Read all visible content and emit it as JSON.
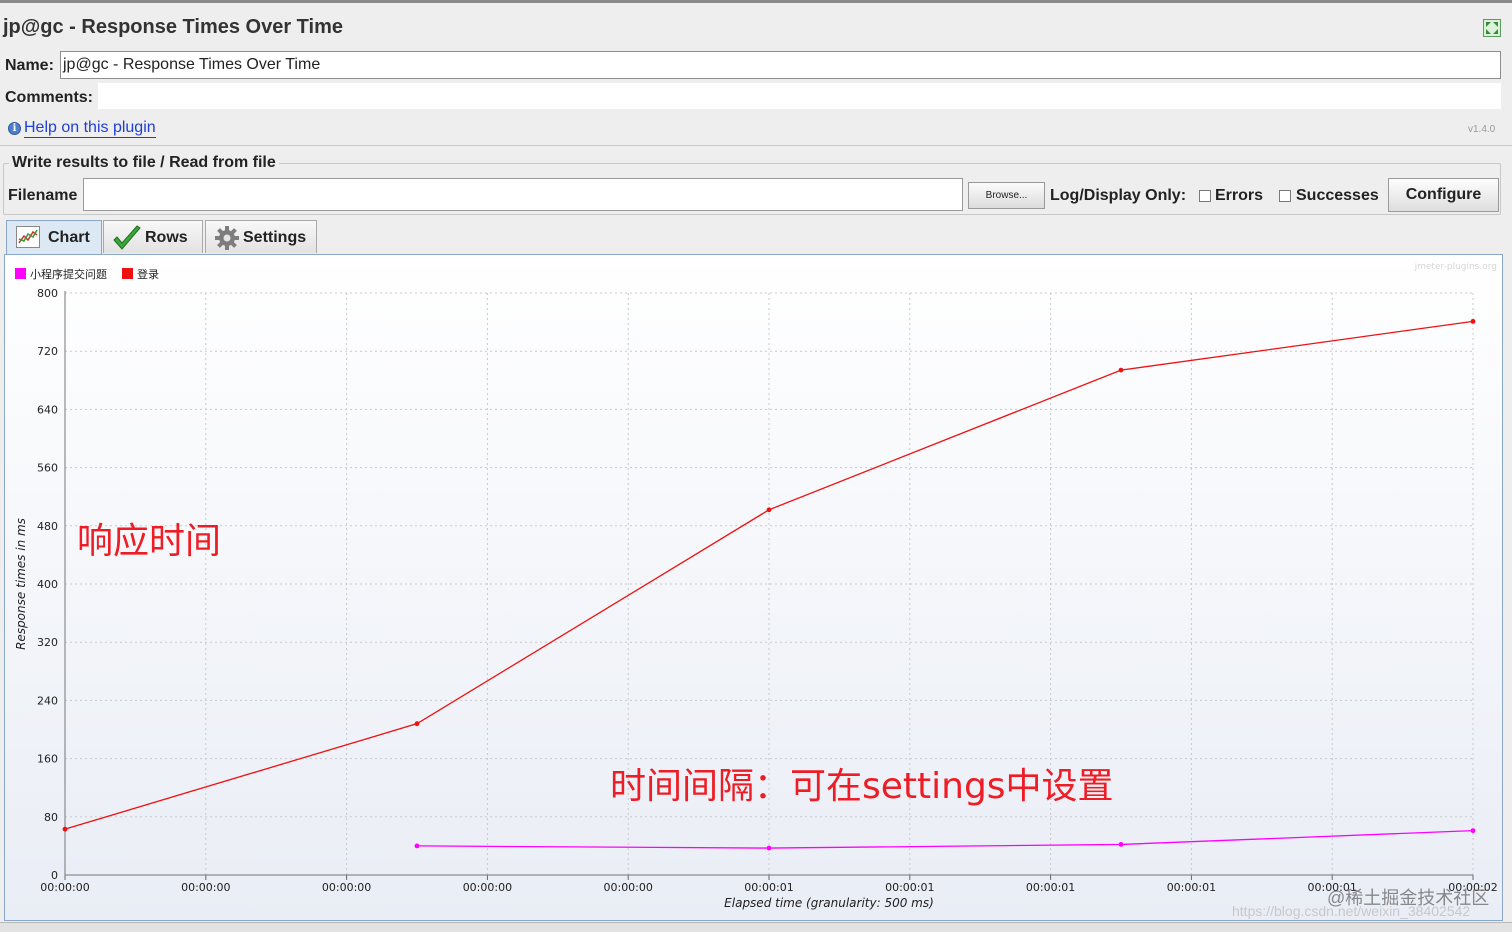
{
  "window": {
    "title": "jp@gc - Response Times Over Time",
    "maximize_icon": "maximize-icon"
  },
  "name_field": {
    "label": "Name:",
    "value": "jp@gc - Response Times Over Time"
  },
  "comments": {
    "label": "Comments:",
    "value": ""
  },
  "help": {
    "icon": "info-icon",
    "link_text": "Help on this plugin",
    "version": "v1.4.0"
  },
  "file_section": {
    "title": "Write results to file / Read from file",
    "filename_label": "Filename",
    "filename_value": "",
    "browse_label": "Browse...",
    "log_display_label": "Log/Display Only:",
    "errors_label": "Errors",
    "errors_checked": false,
    "successes_label": "Successes",
    "successes_checked": false,
    "configure_label": "Configure"
  },
  "tabs": [
    {
      "label": "Chart",
      "icon": "chart-icon",
      "active": true
    },
    {
      "label": "Rows",
      "icon": "checkmark-icon",
      "active": false
    },
    {
      "label": "Settings",
      "icon": "gear-icon",
      "active": false
    }
  ],
  "chart_watermark": "jmeter-plugins.org",
  "chart_data": {
    "type": "line",
    "title": "",
    "xlabel": "Elapsed time (granularity: 500 ms)",
    "ylabel": "Response times in ms",
    "ylim": [
      0,
      800
    ],
    "y_ticks": [
      0,
      80,
      160,
      240,
      320,
      400,
      480,
      560,
      640,
      720,
      800
    ],
    "x_ticks": [
      "00:00:00",
      "00:00:00",
      "00:00:00",
      "00:00:00",
      "00:00:00",
      "00:00:01",
      "00:00:01",
      "00:00:01",
      "00:00:01",
      "00:00:01",
      "00:00:02"
    ],
    "grid": true,
    "legend_position": "top-left",
    "series": [
      {
        "name": "小程序提交问题",
        "color": "#ff00ff",
        "x": [
          2.5,
          5,
          7.5,
          10
        ],
        "values": [
          40,
          37,
          42,
          61
        ]
      },
      {
        "name": "登录",
        "color": "#ee1111",
        "x": [
          0,
          2.5,
          5,
          7.5,
          10
        ],
        "values": [
          63,
          208,
          502,
          694,
          761
        ]
      }
    ]
  },
  "annotations": {
    "response_time": "响应时间",
    "interval": "时间间隔：可在settings中设置"
  },
  "watermarks": {
    "community": "@稀土掘金技术社区",
    "url": "https://blog.csdn.net/weixin_38402542"
  }
}
